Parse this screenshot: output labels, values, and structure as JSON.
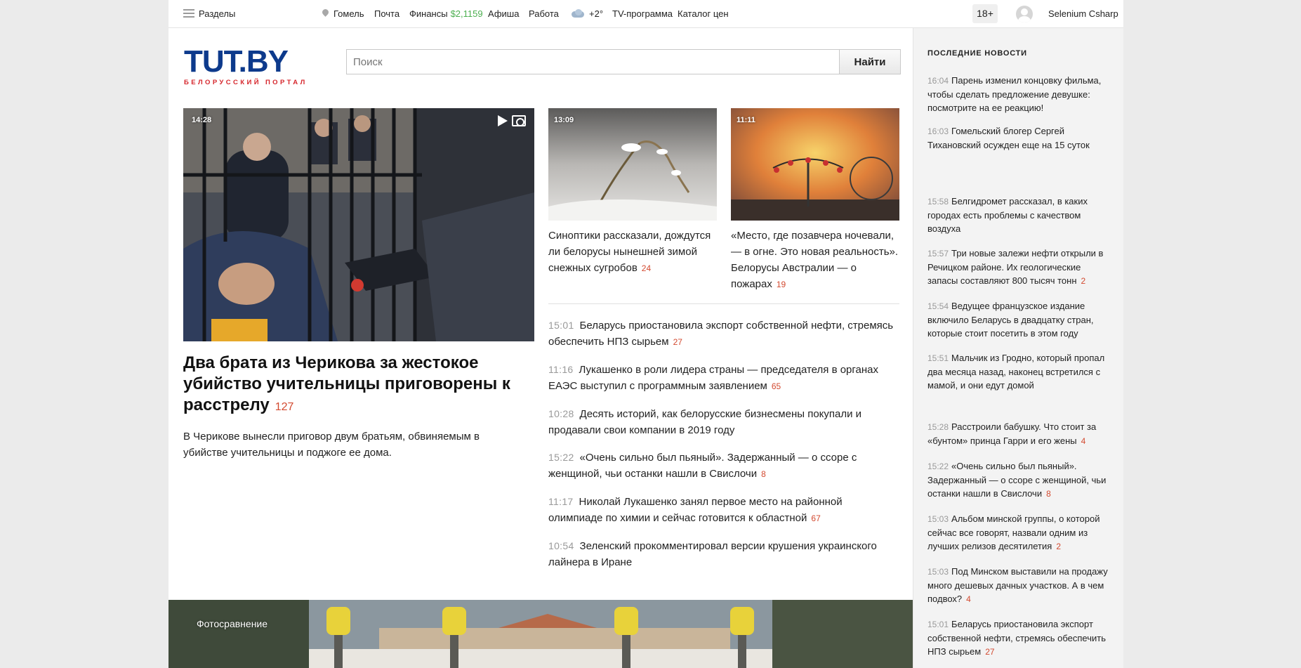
{
  "topbar": {
    "sections": "Разделы",
    "city": "Гомель",
    "mail": "Почта",
    "finance": "Финансы",
    "finance_value": "$2,1159",
    "afisha": "Афиша",
    "work": "Работа",
    "weather": "+2°",
    "tv": "TV-программа",
    "catalog": "Каталог цен",
    "age": "18+",
    "user": "Selenium Csharp"
  },
  "logo": {
    "main": "TUT.BY",
    "sub": "БЕЛОРУССКИЙ ПОРТАЛ"
  },
  "search": {
    "placeholder": "Поиск",
    "button": "Найти"
  },
  "main_story": {
    "time": "14:28",
    "title": "Два брата из Черикова за жестокое убийство учительницы приговорены к расстрелу",
    "count": "127",
    "lead": "В Черикове вынесли приговор двум братьям, обвиняемым в убийстве учительницы и поджоге ее дома."
  },
  "teasers": [
    {
      "time": "13:09",
      "title": "Синоптики рассказали, дождутся ли белорусы нынешней зимой снежных сугробов",
      "count": "24"
    },
    {
      "time": "11:11",
      "title": "«Место, где позавчера ночевали, — в огне. Это новая реальность». Белорусы Австралии — о пожарах",
      "count": "19"
    }
  ],
  "news_list": [
    {
      "time": "15:01",
      "title": "Беларусь приостановила экспорт собственной нефти, стремясь обеспечить НПЗ сырьем",
      "count": "27"
    },
    {
      "time": "11:16",
      "title": "Лукашенко в роли лидера страны — председателя в органах ЕАЭС выступил с программным заявлением",
      "count": "65"
    },
    {
      "time": "10:28",
      "title": "Десять историй, как белорусские бизнесмены покупали и продавали свои компании в 2019 году",
      "count": ""
    },
    {
      "time": "15:22",
      "title": "«Очень сильно был пьяный». Задержанный — о ссоре с женщиной, чьи останки нашли в Свислочи",
      "count": "8"
    },
    {
      "time": "11:17",
      "title": "Николай Лукашенко занял первое место на районной олимпиаде по химии и сейчас готовится к областной",
      "count": "67"
    },
    {
      "time": "10:54",
      "title": "Зеленский прокомментировал версии крушения украинского лайнера в Иране",
      "count": ""
    }
  ],
  "banner": {
    "label": "Фотосравнение"
  },
  "sidebar": {
    "heading": "ПОСЛЕДНИЕ НОВОСТИ",
    "items": [
      {
        "time": "16:04",
        "title": "Парень изменил концовку фильма, чтобы сделать предложение девушке: посмотрите на ее реакцию!",
        "count": ""
      },
      {
        "time": "16:03",
        "title": "Гомельский блогер Сергей Тихановский осужден еще на 15 суток",
        "count": ""
      },
      {
        "time": "15:58",
        "title": "Белгидромет рассказал, в каких городах есть проблемы с качеством воздуха",
        "count": ""
      },
      {
        "time": "15:57",
        "title": "Три новые залежи нефти открыли в Речицком районе. Их геологические запасы составляют 800 тысяч тонн",
        "count": "2"
      },
      {
        "time": "15:54",
        "title": "Ведущее французское издание включило Беларусь в двадцатку стран, которые стоит посетить в этом году",
        "count": ""
      },
      {
        "time": "15:51",
        "title": "Мальчик из Гродно, который пропал два месяца назад, наконец встретился с мамой, и они едут домой",
        "count": ""
      },
      {
        "time": "15:28",
        "title": "Расстроили бабушку. Что стоит за «бунтом» принца Гарри и его жены",
        "count": "4"
      },
      {
        "time": "15:22",
        "title": "«Очень сильно был пьяный». Задержанный — о ссоре с женщиной, чьи останки нашли в Свислочи",
        "count": "8"
      },
      {
        "time": "15:03",
        "title": "Альбом минской группы, о которой сейчас все говорят, назвали одним из лучших релизов десятилетия",
        "count": "2"
      },
      {
        "time": "15:03",
        "title": "Под Минском выставили на продажу много дешевых дачных участков. А в чем подвох?",
        "count": "4"
      },
      {
        "time": "15:01",
        "title": "Беларусь приостановила экспорт собственной нефти, стремясь обеспечить НПЗ сырьем",
        "count": "27"
      }
    ]
  }
}
